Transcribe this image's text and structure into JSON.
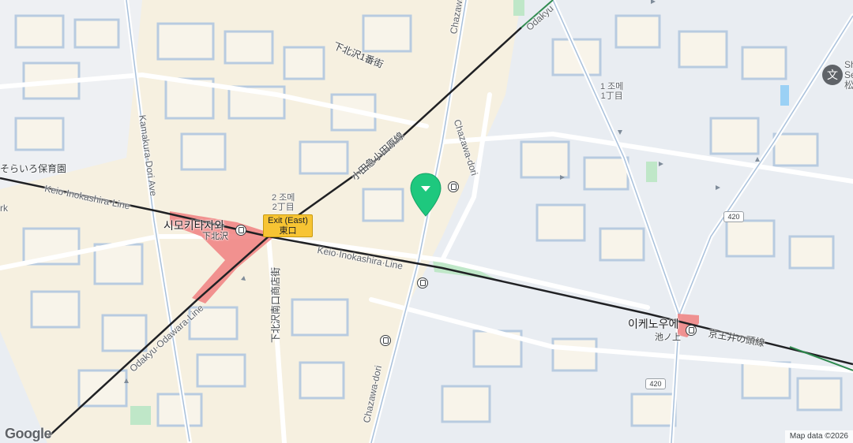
{
  "map": {
    "neighborhood_labels": {
      "shimokitazawa_1": "下北沢1番街",
      "area_1chome_kr": "1 조메",
      "area_1chome_jp": "1丁目",
      "area_2chome_kr": "2 조메",
      "area_2chome_jp": "2丁目",
      "nursery": "そらいろ保育園",
      "park_partial": "rk"
    },
    "streets": {
      "chazawa_top": "Chazawa",
      "chazawa_mid": "Chazawa-dori",
      "chazawa_right": "Chazawa-dori",
      "chazawa_bottom": "Chazawa-dori",
      "kamakura": "Kamakura-Dori Ave",
      "shotengai": "下北沢南口商店街"
    },
    "rail_lines": {
      "odakyu_top": "Odakyu",
      "odakyu_jp": "小田急小田原線",
      "keio_inokashira_left": "Keio·Inokashira·Line",
      "keio_inokashira_mid": "Keio·Inokashira·Line",
      "odakyu_odawara": "Odakyu·Odawara·Line",
      "keio_jp": "京王井の頭線"
    },
    "stations": {
      "shimokitazawa_kr": "시모키타자와",
      "shimokitazawa_jp": "下北沢",
      "ikenoue_kr": "이케노우에",
      "ikenoue_jp": "池ノ上"
    },
    "exit_label": {
      "en": "Exit (East)",
      "jp": "東口"
    },
    "route_badges": [
      "420",
      "420"
    ],
    "poi": {
      "school_label_1": "Sh",
      "school_label_2": "Se",
      "school_label_3": "松"
    },
    "branding": "Google",
    "attribution": "Map data ©2026",
    "colors": {
      "background": "#e9edf2",
      "blocks": "#f8f4ea",
      "roads": "#ffffff",
      "road_edges": "#a8c0db",
      "rail": "#202124",
      "station_platform": "#f08080",
      "pin": "#1ec87e",
      "exit_box": "#f7c433",
      "park": "#bfe7c8"
    }
  }
}
